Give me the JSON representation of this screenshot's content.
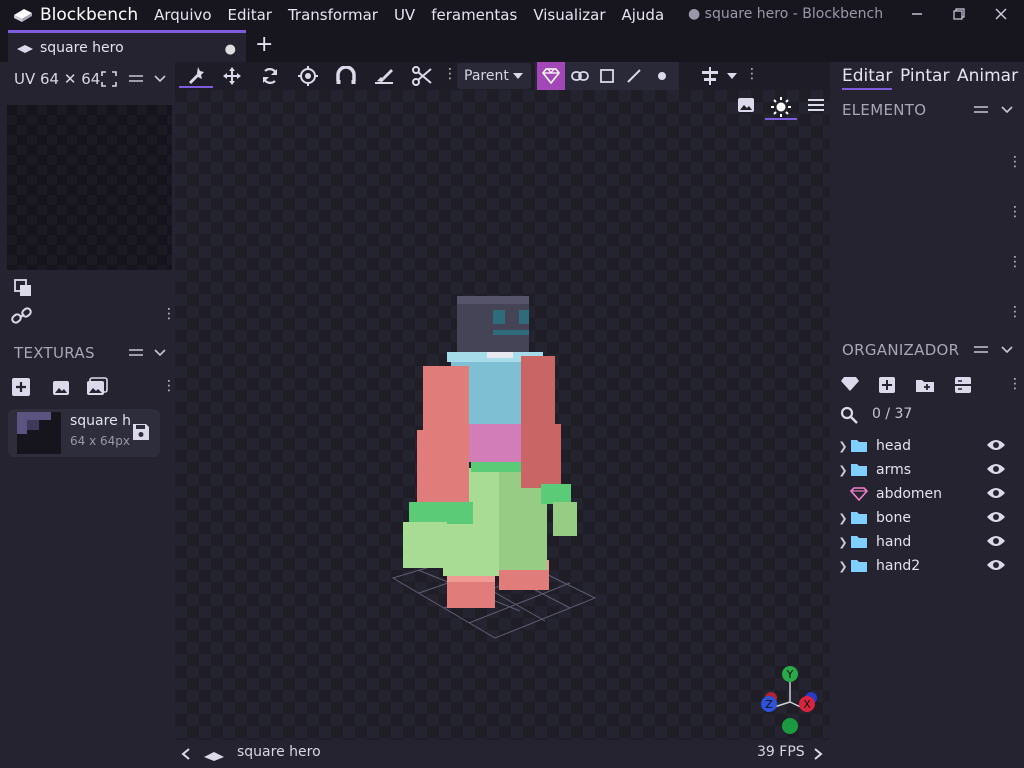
{
  "app": {
    "name": "Blockbench",
    "window_title": "● square hero - Blockbench"
  },
  "menu": [
    "Arquivo",
    "Editar",
    "Transformar",
    "UV",
    "feramentas",
    "Visualizar",
    "Ajuda"
  ],
  "tab": {
    "label": "square hero",
    "modified_marker": "●"
  },
  "uv_panel": {
    "label": "UV 64 ✕ 64"
  },
  "textures": {
    "title": "TEXTURAS",
    "item": {
      "name": "square h",
      "size": "64 x 64px ("
    }
  },
  "toolbar": {
    "parent_select": "Parent"
  },
  "viewport": {
    "status_name": "square hero",
    "fps": "39 FPS"
  },
  "right": {
    "modes": [
      "Editar",
      "Pintar",
      "Animar"
    ],
    "element_title": "ELEMENTO",
    "outliner_title": "ORGANIZADOR",
    "search_count": "0 / 37",
    "tree": [
      {
        "label": "head",
        "kind": "folder"
      },
      {
        "label": "arms",
        "kind": "folder"
      },
      {
        "label": "abdomen",
        "kind": "cube"
      },
      {
        "label": "bone",
        "kind": "folder"
      },
      {
        "label": "hand",
        "kind": "folder"
      },
      {
        "label": "hand2",
        "kind": "folder"
      }
    ]
  },
  "colors": {
    "accent": "#7d5cde",
    "mode_active": "#a347b8",
    "folder": "#7fd0ff"
  }
}
